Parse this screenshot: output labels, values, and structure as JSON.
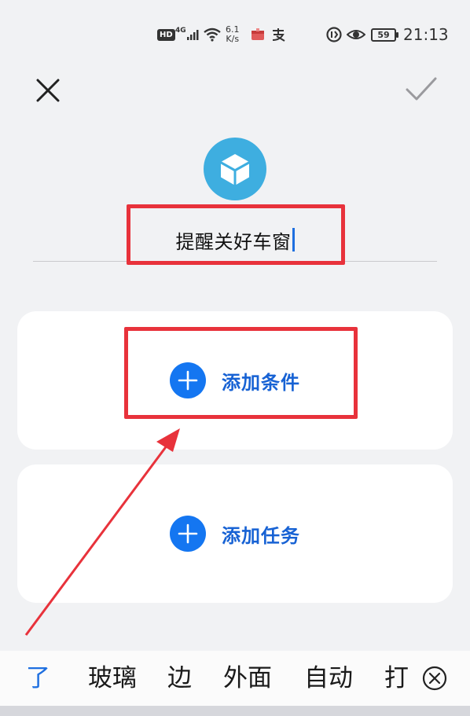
{
  "status_bar": {
    "hd": "HD",
    "network": "4G",
    "net_speed_value": "6.1",
    "net_speed_unit": "K/s",
    "battery": "59",
    "time": "21:13"
  },
  "header": {
    "close_icon": "close-icon",
    "confirm_icon": "check-icon"
  },
  "scene": {
    "icon": "cube-icon",
    "icon_color": "#3eaee0",
    "name": "提醒关好车窗"
  },
  "cards": {
    "condition_label": "添加条件",
    "task_label": "添加任务",
    "accent_color": "#1476f1"
  },
  "annotation": {
    "highlight_color": "#e8323b"
  },
  "suggestions": {
    "items": [
      "了",
      "玻璃",
      "边",
      "外面",
      "自动",
      "打"
    ],
    "collapse_icon": "circle-x-icon"
  }
}
